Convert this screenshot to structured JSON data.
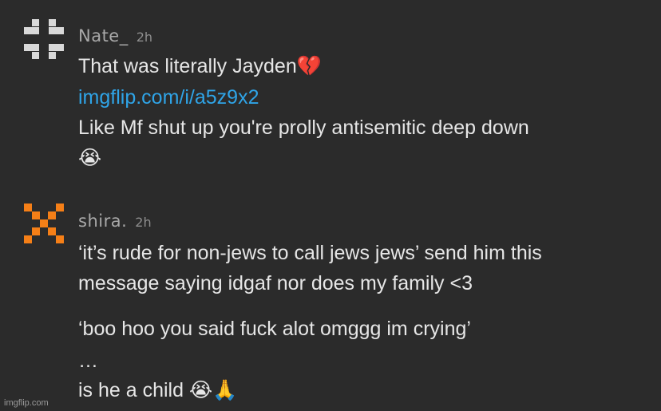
{
  "comments": [
    {
      "username": "Nate_",
      "time": "2h",
      "avatar_icon": "gray-pixel-cross-icon",
      "avatar_color": "#d9d9d9",
      "lines": [
        {
          "text": "That was literally Jayden",
          "emoji": "💔"
        },
        {
          "link": "imgflip.com/i/a5z9x2"
        },
        {
          "text": "Like Mf shut up you're prolly antisemitic deep down"
        },
        {
          "emoji": "😭"
        }
      ]
    },
    {
      "username": "shira.",
      "time": "2h",
      "avatar_icon": "orange-pixel-x-icon",
      "avatar_color": "#f57f17",
      "lines": [
        {
          "text": "‘it’s rude for non-jews to call jews jews’ send him this"
        },
        {
          "text": "message saying idgaf nor does my family <3"
        },
        {
          "text": "‘boo hoo you said fuck alot omggg im crying’"
        },
        {
          "text": "…"
        },
        {
          "text": "is he a child ",
          "emoji": "😭🙏"
        }
      ]
    }
  ],
  "colors": {
    "background": "#2b2b2b",
    "text": "#e6e6e6",
    "username": "#a9a9a9",
    "link": "#2fa4e7"
  },
  "watermark": "imgflip.com"
}
